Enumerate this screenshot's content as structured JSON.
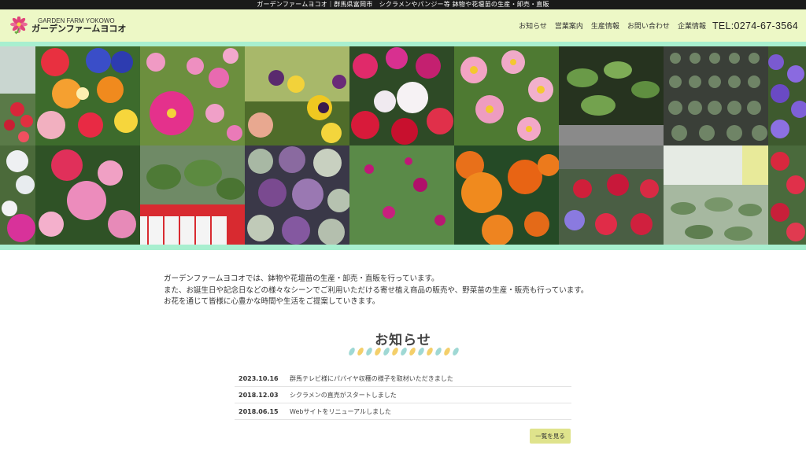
{
  "topbar": {
    "text": "ガーデンファームヨコオ｜群馬県富岡市　シクラメンやパンジー等 鉢物や花壇苗の生産・卸売・直販"
  },
  "header": {
    "logo_en": "GARDEN FARM YOKOWO",
    "logo_jp": "ガーデンファームヨコオ",
    "nav": [
      "お知らせ",
      "営業案内",
      "生産情報",
      "お問い合わせ",
      "企業情報"
    ],
    "tel": "TEL:0274-67-3564"
  },
  "intro": {
    "lines": [
      "ガーデンファームヨコオでは、鉢物や花壇苗の生産・卸売・直販を行っています。",
      "また、お誕生日や記念日などの様々なシーンでご利用いただける寄せ植え商品の販売や、野菜苗の生産・販売も行っています。",
      "お花を通じて皆様に心豊かな時間や生活をご提案していきます。"
    ]
  },
  "news": {
    "heading": "お知らせ",
    "items": [
      {
        "date": "2023.10.16",
        "title": "群馬テレビ様にパパイヤ収穫の様子を取材いただきました"
      },
      {
        "date": "2018.12.03",
        "title": "シクラメンの直売がスタートしました"
      },
      {
        "date": "2018.06.15",
        "title": "Webサイトをリニューアルしました"
      }
    ],
    "more_label": "一覧を見る"
  },
  "colors": {
    "header_bg": "#edf8c6",
    "stripe": "#a8efcf",
    "button_bg": "#dfe38c",
    "topbar_bg": "#1a1a1a"
  },
  "mosaic_photos": [
    "greenhouse-flowers",
    "pansy-viola-mix",
    "cosmos-pink",
    "pansy-yellow-purple",
    "cyclamen-red-white",
    "marguerite-pink",
    "vegetable-seedlings",
    "seedling-trays",
    "purple-violas",
    "white-flowers",
    "pentas-pink",
    "tomato-seedlings-crate",
    "ornamental-kale",
    "gomphrena-purple",
    "marigold-orange",
    "verbena-red",
    "seedlings-closeup",
    "red-flowers-edge"
  ]
}
